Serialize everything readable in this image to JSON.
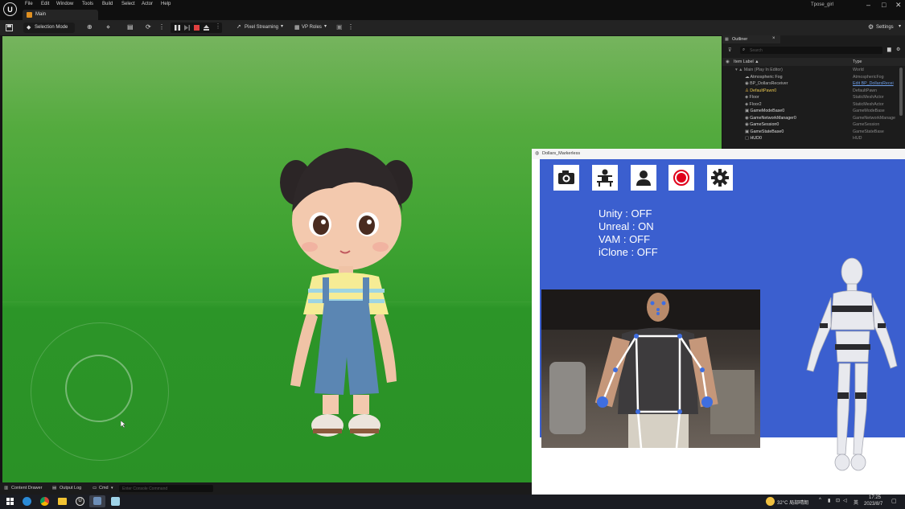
{
  "menu": [
    "File",
    "Edit",
    "Window",
    "Tools",
    "Build",
    "Select",
    "Actor",
    "Help"
  ],
  "tab": {
    "label": "Main"
  },
  "project_name": "Tpose_girl",
  "window_controls": {
    "minimize": "–",
    "maximize": "□",
    "close": "✕"
  },
  "toolbar": {
    "selection_mode": "Selection Mode",
    "pixel_streaming": "Pixel Streaming",
    "vp_roles": "VP Roles",
    "settings": "Settings"
  },
  "outliner": {
    "title": "Outliner",
    "search_placeholder": "Search",
    "col_label": "Item Label ▲",
    "col_type": "Type",
    "rows": [
      {
        "label": "Main (Play In Editor)",
        "type": "World"
      },
      {
        "label": "Atmospheric Fog",
        "type": "AtmosphericFog"
      },
      {
        "label": "BP_DollarsReceiver",
        "type": "Edit BP_DollarsRecei"
      },
      {
        "label": "DefaultPawn0",
        "type": "DefaultPawn"
      },
      {
        "label": "Floor",
        "type": "StaticMeshActor"
      },
      {
        "label": "Floor2",
        "type": "StaticMeshActor"
      },
      {
        "label": "GameModeBase0",
        "type": "GameModeBase"
      },
      {
        "label": "GameNetworkManager0",
        "type": "GameNetworkManage"
      },
      {
        "label": "GameSession0",
        "type": "GameSession"
      },
      {
        "label": "GameStateBase0",
        "type": "GameStateBase"
      },
      {
        "label": "HUD0",
        "type": "HUD"
      }
    ]
  },
  "popup": {
    "title": "Dollars_Markerless",
    "status": [
      {
        "name": "Unity",
        "value": ": OFF"
      },
      {
        "name": "Unreal",
        "value": ": ON"
      },
      {
        "name": "VAM",
        "value": ": OFF"
      },
      {
        "name": "iClone",
        "value": ": OFF"
      }
    ]
  },
  "bottombar": {
    "content_drawer": "Content Drawer",
    "output_log": "Output Log",
    "cmd": "Cmd",
    "console_placeholder": "Enter Console Command"
  },
  "taskbar": {
    "weather": "32°C 局部晴朗",
    "lang": "英",
    "time": "17:25",
    "date": "2023/8/7"
  },
  "colors": {
    "accent_blue": "#3b5fcf",
    "record_red": "#e0001b",
    "viewport_green": "#3fa332"
  }
}
